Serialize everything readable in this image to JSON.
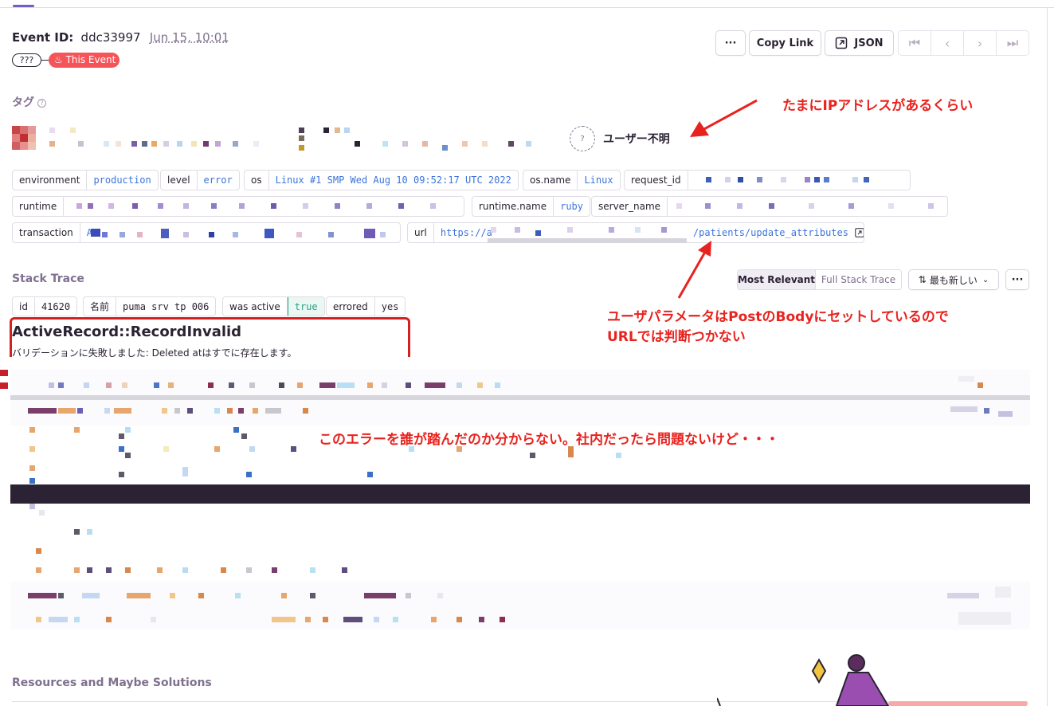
{
  "header": {
    "event_id_label": "Event ID:",
    "event_id": "ddc33997",
    "date": "Jun 15, 10:01",
    "unknown_pill": "???",
    "this_event": "This Event",
    "more_label": "···",
    "copy_link": "Copy Link",
    "json": "JSON",
    "nav": {
      "first": "⏮",
      "prev": "‹",
      "next": "›",
      "last": "⏭"
    }
  },
  "tags_section": {
    "title": "タグ",
    "help": "?",
    "user_unknown": "ユーザー不明",
    "user_icon": "?",
    "tags": [
      {
        "key": "environment",
        "value": "production"
      },
      {
        "key": "level",
        "value": "error"
      },
      {
        "key": "os",
        "value": "Linux #1 SMP Wed Aug 10 09:52:17 UTC 2022"
      },
      {
        "key": "os.name",
        "value": "Linux"
      },
      {
        "key": "request_id",
        "value": ""
      },
      {
        "key": "runtime",
        "value": ""
      },
      {
        "key": "runtime.name",
        "value": "ruby"
      },
      {
        "key": "server_name",
        "value": ""
      },
      {
        "key": "transaction",
        "value": "A"
      },
      {
        "key": "url",
        "value_prefix": "https://a",
        "value_suffix": "/patients/update_attributes"
      }
    ]
  },
  "stack_trace": {
    "title": "Stack Trace",
    "seg_most": "Most Relevant",
    "seg_full": "Full Stack Trace",
    "sort_label": "最も新しい",
    "more": "···",
    "thread_tags": [
      {
        "key": "id",
        "value": "41620"
      },
      {
        "key": "名前",
        "value": "puma srv tp 006"
      },
      {
        "key": "was active",
        "value": "true"
      },
      {
        "key": "errored",
        "value": "yes"
      }
    ],
    "error_title": "ActiveRecord::RecordInvalid",
    "error_message": "バリデーションに失敗しました: Deleted atはすでに存在します。"
  },
  "resources": {
    "title": "Resources and Maybe Solutions"
  },
  "annotations": {
    "ip": "たまにIPアドレスがあるくらい",
    "url_line1": "ユーザパラメータはPostのBodyにセットしているので",
    "url_line2": "URLでは判断つかない",
    "error": "このエラーを誰が踏んだのか分からない。社内だったら問題ないけど・・・"
  },
  "colors": {
    "accent": "#6c5fc7",
    "annotation_red": "#e8231f",
    "this_event_red": "#f55459",
    "tag_value_blue": "#3d74db",
    "true_green": "#2ba185"
  }
}
